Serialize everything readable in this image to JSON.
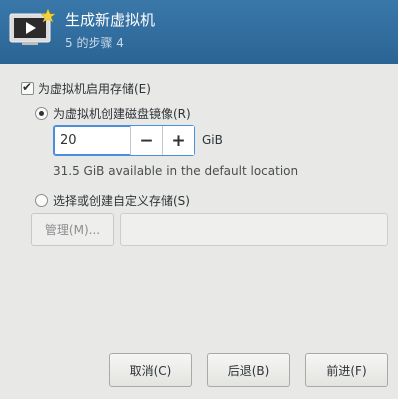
{
  "header": {
    "title": "生成新虚拟机",
    "subtitle": "5 的步骤 4",
    "icon": "vm-monitor-star-icon",
    "background": "#2f6b9b"
  },
  "storage": {
    "enable_label": "为虚拟机启用存储(E)",
    "enable_checked": true,
    "create_image_label": "为虚拟机创建磁盘镜像(R)",
    "create_image_selected": true,
    "size_value": "20",
    "size_unit": "GiB",
    "decrement_label": "−",
    "increment_label": "+",
    "available_text": "31.5 GiB available in the default location",
    "custom_label": "选择或创建自定义存储(S)",
    "custom_selected": false,
    "manage_label": "管理(M)...",
    "path_value": ""
  },
  "footer": {
    "cancel_label": "取消(C)",
    "back_label": "后退(B)",
    "forward_label": "前进(F)"
  }
}
